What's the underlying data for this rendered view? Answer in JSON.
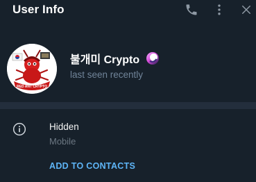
{
  "header": {
    "title": "User Info",
    "call_icon": "phone-icon",
    "menu_icon": "more-vertical-icon",
    "close_icon": "close-icon"
  },
  "profile": {
    "name": "불개미 Crypto",
    "last_seen": "last seen recently",
    "avatar_icon": "red-ant-crypto-logo",
    "status_icon": "gradient-circle-emoji"
  },
  "info": {
    "icon": "info-icon",
    "phone": "Hidden",
    "phone_label": "Mobile",
    "add_contact": "ADD TO CONTACTS"
  },
  "colors": {
    "background": "#17212b",
    "divider": "#232e3c",
    "accent": "#5eb5f7",
    "secondary_text": "#708499"
  }
}
